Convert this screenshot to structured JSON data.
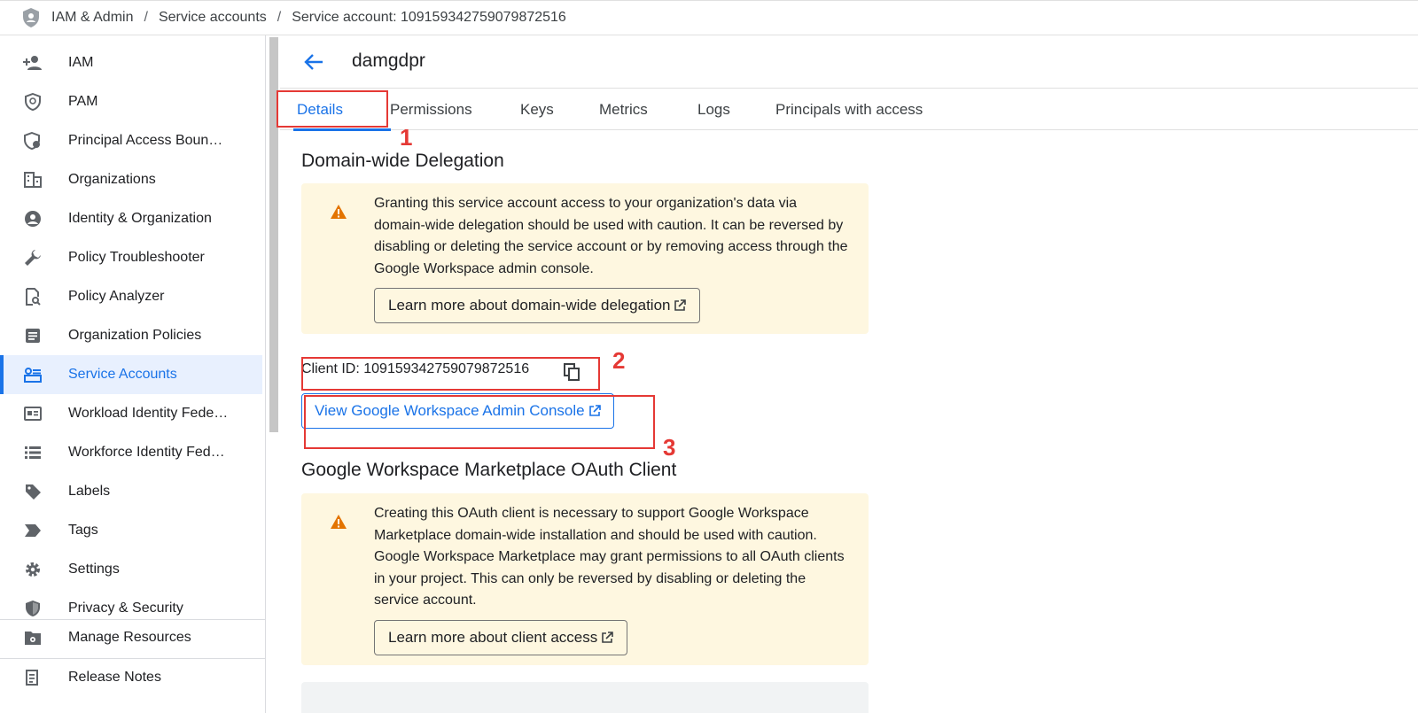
{
  "breadcrumb": {
    "icon": "shield-icon",
    "items": [
      "IAM & Admin",
      "Service accounts",
      "Service account: 109159342759079872516"
    ]
  },
  "sidebar": {
    "items": [
      {
        "label": "IAM",
        "icon": "person-add-icon"
      },
      {
        "label": "PAM",
        "icon": "shield-clock-icon"
      },
      {
        "label": "Principal Access Boun…",
        "icon": "shield-gear-icon"
      },
      {
        "label": "Organizations",
        "icon": "building-icon"
      },
      {
        "label": "Identity & Organization",
        "icon": "account-circle-icon"
      },
      {
        "label": "Policy Troubleshooter",
        "icon": "wrench-icon"
      },
      {
        "label": "Policy Analyzer",
        "icon": "document-search-icon"
      },
      {
        "label": "Organization Policies",
        "icon": "policy-list-icon"
      },
      {
        "label": "Service Accounts",
        "icon": "service-account-icon",
        "active": true
      },
      {
        "label": "Workload Identity Fede…",
        "icon": "id-card-icon"
      },
      {
        "label": "Workforce Identity Fed…",
        "icon": "list-icon"
      },
      {
        "label": "Labels",
        "icon": "label-icon"
      },
      {
        "label": "Tags",
        "icon": "tag-icon"
      },
      {
        "label": "Settings",
        "icon": "gear-icon"
      },
      {
        "label": "Privacy & Security",
        "icon": "shield-check-icon"
      }
    ],
    "footer_items": [
      {
        "label": "Manage Resources",
        "icon": "folder-gear-icon"
      },
      {
        "label": "Release Notes",
        "icon": "notes-icon"
      }
    ]
  },
  "header": {
    "title": "damgdpr"
  },
  "tabs": [
    "Details",
    "Permissions",
    "Keys",
    "Metrics",
    "Logs",
    "Principals with access"
  ],
  "delegation": {
    "title": "Domain-wide Delegation",
    "warning": "Granting this service account access to your organization's data via domain-wide delegation should be used with caution. It can be reversed by disabling or deleting the service account or by removing access through the Google Workspace admin console.",
    "learn_more": "Learn more about domain-wide delegation",
    "client_id": "Client ID: 109159342759079872516",
    "console_button": "View Google Workspace Admin Console"
  },
  "marketplace": {
    "title": "Google Workspace Marketplace OAuth Client",
    "warning": "Creating this OAuth client is necessary to support Google Workspace Marketplace domain-wide installation and should be used with caution. Google Workspace Marketplace may grant permissions to all OAuth clients in your project. This can only be reversed by disabling or deleting the service account.",
    "learn_more": "Learn more about client access"
  },
  "annotations": [
    "1",
    "2",
    "3"
  ],
  "colors": {
    "accent": "#1a73e8",
    "warning_bg": "#fef7e0",
    "warning_icon": "#e37400",
    "annotation": "#e53935"
  }
}
